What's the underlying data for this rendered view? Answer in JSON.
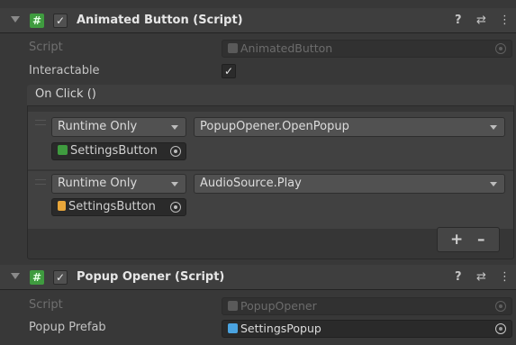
{
  "component1": {
    "title": "Animated Button (Script)",
    "enabled_mark": "✓",
    "script_label": "Script",
    "script_value": "AnimatedButton",
    "interactable_label": "Interactable",
    "interactable_mark": "✓"
  },
  "on_click": {
    "header": "On Click ()",
    "entries": [
      {
        "mode": "Runtime Only",
        "function": "PopupOpener.OpenPopup",
        "target": "SettingsButton",
        "target_icon": "script-icon"
      },
      {
        "mode": "Runtime Only",
        "function": "AudioSource.Play",
        "target": "SettingsButton",
        "target_icon": "audio-source-icon"
      }
    ],
    "add_label": "+",
    "remove_label": "–"
  },
  "component2": {
    "title": "Popup Opener (Script)",
    "enabled_mark": "✓",
    "script_label": "Script",
    "script_value": "PopupOpener",
    "prefab_label": "Popup Prefab",
    "prefab_value": "SettingsPopup"
  },
  "header_icons": {
    "help": "?",
    "settings": "⇄",
    "menu": "⋮"
  },
  "colors": {
    "script_green": "#3f9b3f",
    "audio_yellow": "#e8a63a",
    "prefab_blue": "#4aa3e0"
  }
}
